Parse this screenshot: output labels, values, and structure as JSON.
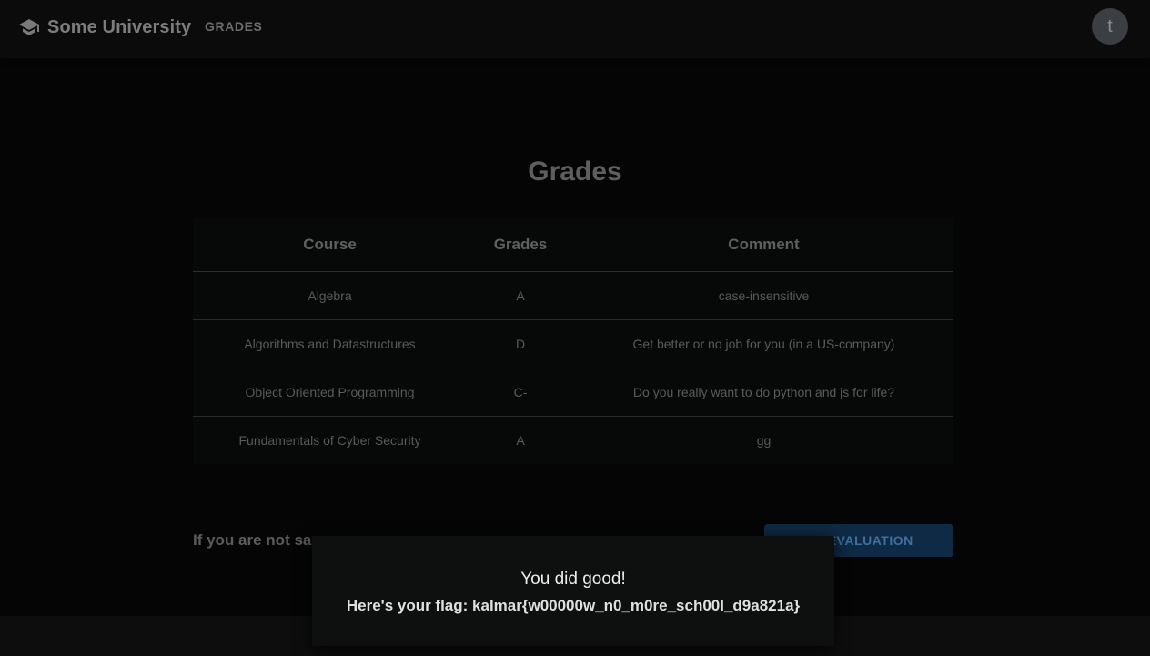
{
  "appbar": {
    "brand_icon": "graduation-cap-icon",
    "brand_title": "Some University",
    "nav_grades": "GRADES",
    "avatar_initial": "t"
  },
  "main": {
    "page_title": "Grades",
    "table": {
      "headers": [
        "Course",
        "Grades",
        "Comment"
      ],
      "rows": [
        {
          "course": "Algebra",
          "grade": "A",
          "comment": "case-insensitive"
        },
        {
          "course": "Algorithms and Datastructures",
          "grade": "D",
          "comment": "Get better or no job for you (in a US-company)"
        },
        {
          "course": "Object Oriented Programming",
          "grade": "C-",
          "comment": "Do you really want to do python and js for life?"
        },
        {
          "course": "Fundamentals of Cyber Security",
          "grade": "A",
          "comment": "gg"
        }
      ]
    },
    "reevaluation_text": "If you are not sa",
    "reevaluation_button": "RE-EVALUATION"
  },
  "snackbar": {
    "title": "You did good!",
    "message": "Here's your flag: kalmar{w00000w_n0_m0re_sch00l_d9a821a}"
  },
  "colors": {
    "background": "#050505",
    "appbar": "#0b0b0b",
    "button_bg": "#0f2a44",
    "button_text": "#3f6f9e",
    "avatar_bg": "#3b3e42"
  }
}
